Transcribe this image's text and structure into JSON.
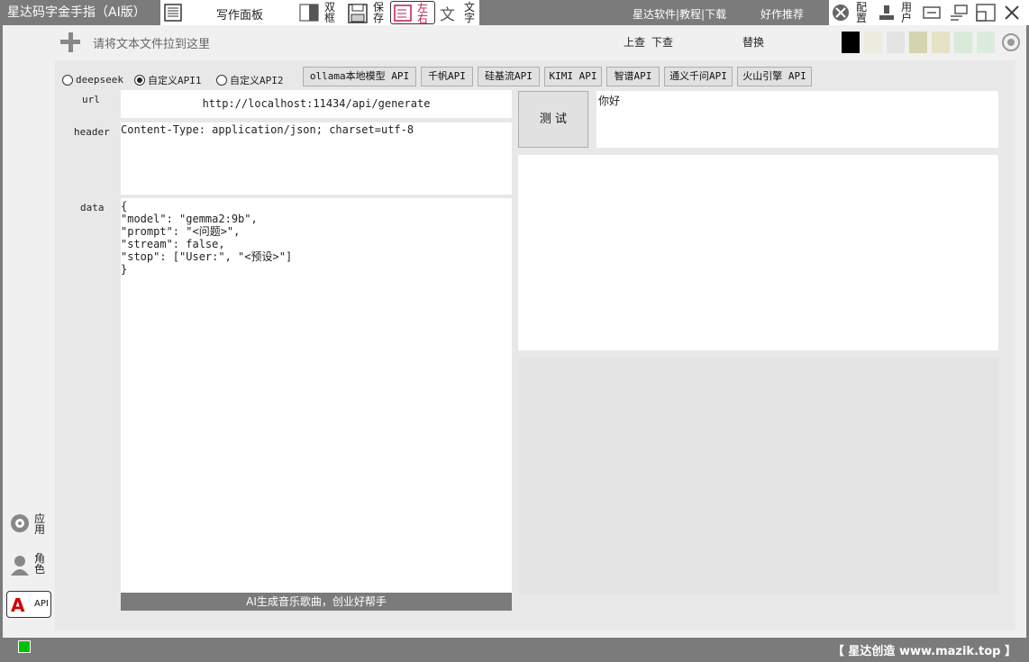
{
  "app": {
    "title": "星达码字金手指（AI版）"
  },
  "toolbar": {
    "write_panel": "写作面板",
    "dual": "双框",
    "save": "保存",
    "left_right": "左右",
    "text": "文字"
  },
  "top_links": {
    "software": "星达软件|教程|下载",
    "recommend": "好作推荐"
  },
  "right_tools": {
    "config": "配置",
    "user": "用户"
  },
  "file_drop": {
    "placeholder": "请将文本文件拉到这里"
  },
  "search": {
    "up": "上查",
    "down": "下查",
    "replace": "替换"
  },
  "swatches": [
    "#000000",
    "#ebebdf",
    "#e4e4e4",
    "#d4d4b0",
    "#e4e4c4",
    "#d9ead9",
    "#dcecdc"
  ],
  "api_options": [
    {
      "label": "deepseek",
      "selected": false
    },
    {
      "label": "自定义API1",
      "selected": true
    },
    {
      "label": "自定义API2",
      "selected": false
    }
  ],
  "api_buttons": [
    "ollama本地模型 API",
    "千帆API",
    "硅基流API",
    "KIMI API",
    "智谱API",
    "通义千问API",
    "火山引擎 API"
  ],
  "form": {
    "url_label": "url",
    "url_value": "http://localhost:11434/api/generate",
    "header_label": "header",
    "header_value": "Content-Type: application/json; charset=utf-8",
    "data_label": "data",
    "data_value": "{\n\"model\": \"gemma2:9b\",\n\"prompt\": \"<问题>\",\n\"stream\": false,\n\"stop\": [\"User:\", \"<预设>\"]\n}"
  },
  "test_button": "测 试",
  "test_input": "你好",
  "banner": "AI生成音乐歌曲，创业好帮手",
  "sidebar": {
    "app": "应用",
    "role": "角色",
    "api": "API"
  },
  "status": {
    "brand": "【 星达创造 www.mazik.top 】",
    "indicator_color": "#00c000"
  }
}
